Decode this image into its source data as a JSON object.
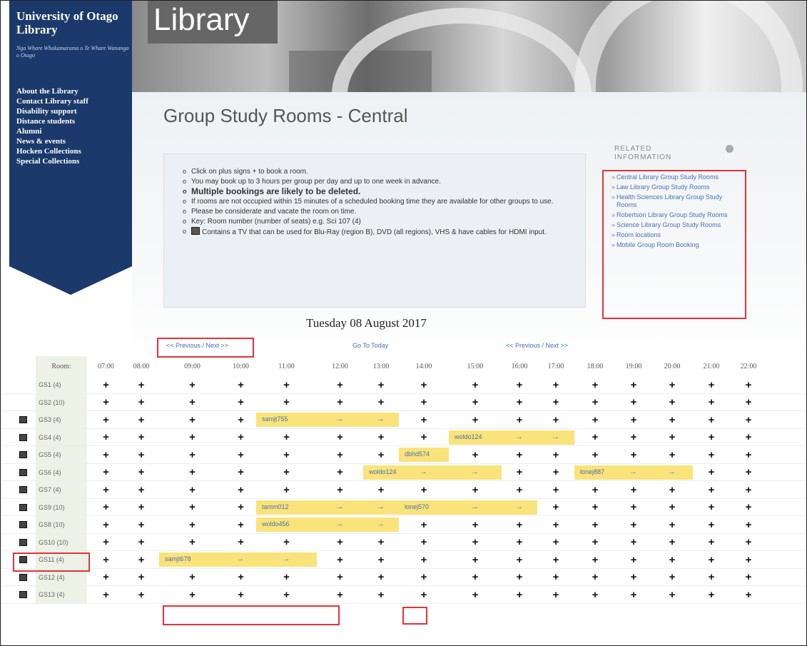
{
  "sidebar": {
    "title": "University of Otago Library",
    "subtitle": "Nga Whare Whakamarama o Te Whare Wananga o Otago",
    "nav": [
      "About the Library",
      "Contact Library staff",
      "Disability support",
      "Distance students",
      "Alumni",
      "News & events",
      "Hocken Collections",
      "Special Collections"
    ]
  },
  "banner": {
    "library_label": "Library"
  },
  "page": {
    "title": "Group Study Rooms - Central",
    "instructions": [
      "Click on plus signs + to book a room.",
      "You may book up to 3 hours per group per day and up to one week in advance.",
      "Multiple bookings are likely to be deleted.",
      "If rooms are not occupied within 15 minutes of a scheduled booking time they are available for other groups to use.",
      "Please be considerate and vacate the room on time.",
      "Key: Room number (number of seats) e.g. Sci 107 (4)",
      "Contains a TV that can be used for Blu-Ray (region B), DVD (all regions), VHS & have cables for HDMI input."
    ]
  },
  "related": {
    "heading": "RELATED INFORMATION",
    "links": [
      "Central Library Group Study Rooms",
      "Law Library Group Study Rooms",
      "Health Sciences Library Group Study Rooms",
      "Robertson Library Group Study Rooms",
      "Science Library Group Study Rooms",
      "Room locations",
      "Mobile Group Room Booking"
    ]
  },
  "schedule": {
    "date": "Tuesday 08 August 2017",
    "nav_left": "<< Previous / Next >>",
    "nav_center": "Go To Today",
    "nav_right": "<< Previous / Next >>",
    "room_header": "Room:",
    "times": [
      "07:00",
      "08:00",
      "09:00",
      "10:00",
      "11:00",
      "12:00",
      "13:00",
      "14:00",
      "15:00",
      "16:00",
      "17:00",
      "18:00",
      "19:00",
      "20:00",
      "21:00",
      "22:00"
    ],
    "plus_symbol": "+",
    "arrow_symbol": "→",
    "rooms": [
      {
        "name": "GS1 (4)",
        "tv": false,
        "bookings": []
      },
      {
        "name": "GS2 (10)",
        "tv": false,
        "bookings": []
      },
      {
        "name": "GS3 (4)",
        "tv": true,
        "bookings": [
          {
            "user": "samjt755",
            "start": 4,
            "span": 3
          }
        ]
      },
      {
        "name": "GS4 (4)",
        "tv": true,
        "bookings": [
          {
            "user": "woldo124",
            "start": 8,
            "span": 3
          }
        ]
      },
      {
        "name": "GS5 (4)",
        "tv": true,
        "bookings": [
          {
            "user": "dbhd574",
            "start": 7,
            "span": 1
          }
        ]
      },
      {
        "name": "GS6 (4)",
        "tv": true,
        "bookings": [
          {
            "user": "woldo124",
            "start": 6,
            "span": 3
          },
          {
            "user": "lonej887",
            "start": 11,
            "span": 3
          }
        ]
      },
      {
        "name": "GS7 (4)",
        "tv": true,
        "bookings": []
      },
      {
        "name": "GS9 (10)",
        "tv": true,
        "bookings": [
          {
            "user": "tamm012",
            "start": 4,
            "span": 3
          },
          {
            "user": "lonej570",
            "start": 7,
            "span": 3
          }
        ]
      },
      {
        "name": "GS8 (10)",
        "tv": true,
        "bookings": [
          {
            "user": "woldo456",
            "start": 4,
            "span": 3
          }
        ]
      },
      {
        "name": "GS10 (10)",
        "tv": true,
        "bookings": []
      },
      {
        "name": "GS11 (4)",
        "tv": true,
        "bookings": [
          {
            "user": "samjt678",
            "start": 2,
            "span": 3
          }
        ]
      },
      {
        "name": "GS12 (4)",
        "tv": true,
        "bookings": []
      },
      {
        "name": "GS13 (4)",
        "tv": true,
        "bookings": []
      }
    ]
  }
}
